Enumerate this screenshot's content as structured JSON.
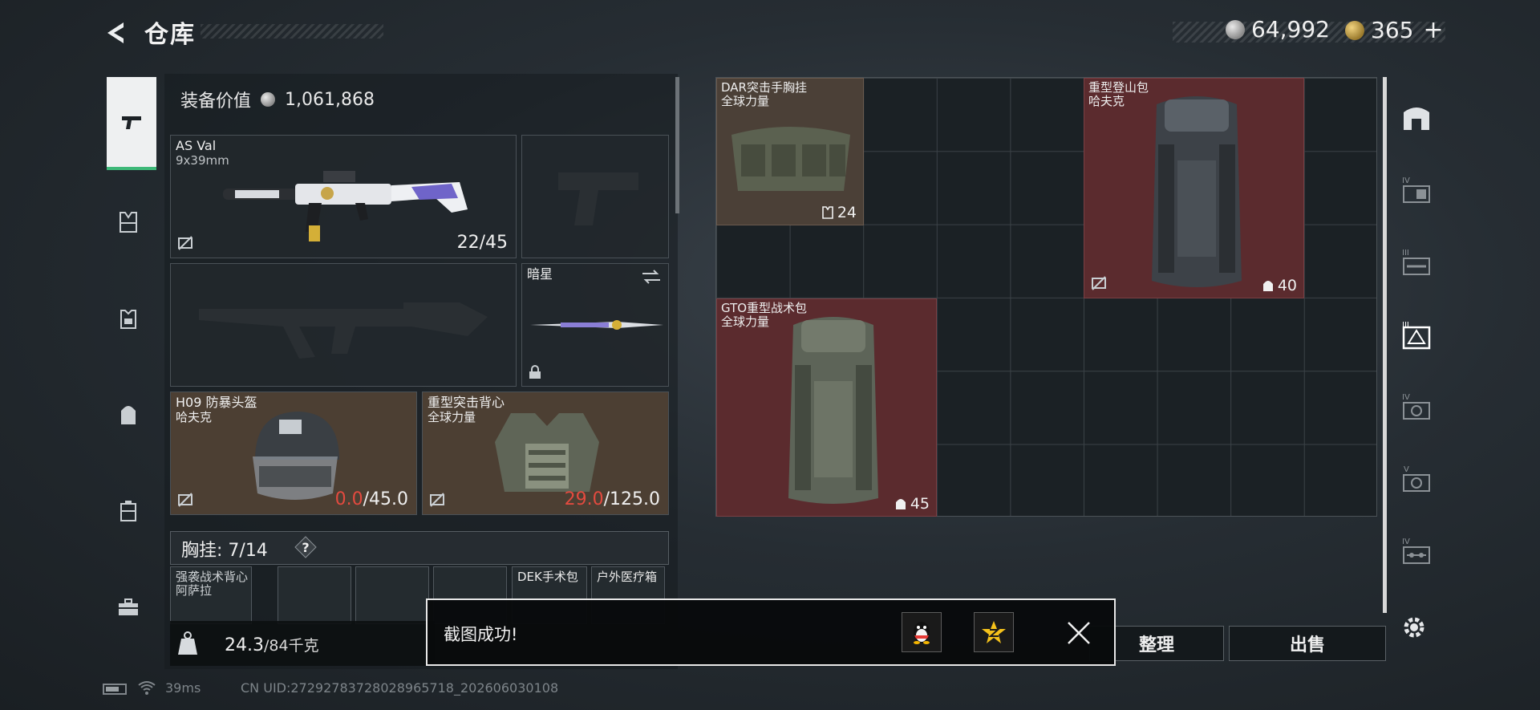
{
  "header": {
    "title": "仓库",
    "silver_amount": "64,992",
    "gold_amount": "365",
    "plus": "+"
  },
  "left_nav": [
    {
      "icon": "pistol-icon",
      "active": true
    },
    {
      "icon": "chest-rig-icon"
    },
    {
      "icon": "armor-vest-icon"
    },
    {
      "icon": "backpack-icon"
    },
    {
      "icon": "case-icon"
    },
    {
      "icon": "toolbox-icon"
    }
  ],
  "loadout": {
    "equip_value_label": "装备价值",
    "equip_value": "1,061,868",
    "primary_weapon": {
      "name": "AS Val",
      "caliber": "9x39mm",
      "ammo": "22/45"
    },
    "melee": {
      "name": "暗星"
    },
    "helmet": {
      "name": "H09 防暴头盔",
      "maker": "哈夫克",
      "durability_current": "0.0",
      "durability_max": "/45.0"
    },
    "armor": {
      "name": "重型突击背心",
      "maker": "全球力量",
      "durability_current": "29.0",
      "durability_max": "/125.0"
    },
    "chest_rig_label": "胸挂: 7/14",
    "help": "?",
    "small_slots": [
      {
        "label": "强袭战术背心\n阿萨拉"
      },
      {
        "label": ""
      },
      {
        "label": ""
      },
      {
        "label": ""
      },
      {
        "label": "DEK手术包"
      },
      {
        "label": "户外医疗箱"
      }
    ],
    "weight_value": "24.3",
    "weight_max": "/84千克"
  },
  "storage": {
    "items": [
      {
        "name": "DAR突击手胸挂",
        "maker": "全球力量",
        "count": "24",
        "color": "brown"
      },
      {
        "name": "重型登山包",
        "maker": "哈夫克",
        "count": "40",
        "color": "red"
      },
      {
        "name": "GTO重型战术包",
        "maker": "全球力量",
        "count": "45",
        "color": "red"
      }
    ]
  },
  "right_nav": [
    {
      "icon": "safe-box-icon"
    },
    {
      "icon": "tier4-container-icon",
      "tier": "IV"
    },
    {
      "icon": "tier3-container-icon",
      "tier": "III"
    },
    {
      "icon": "tier3-warning-container-icon",
      "tier": "III",
      "active": true
    },
    {
      "icon": "tier4-gear-container-icon",
      "tier": "IV"
    },
    {
      "icon": "tier5-gear-container-icon",
      "tier": "V"
    },
    {
      "icon": "tier4-pipe-container-icon",
      "tier": "IV"
    }
  ],
  "actions": {
    "sort_label": "整理",
    "sell_label": "出售"
  },
  "toast": {
    "message": "截图成功!"
  },
  "status_bar": {
    "ping": "39ms",
    "uid": "CN UID:2729278372802896571​8_202606030108"
  },
  "colors": {
    "accent_green": "#3db878",
    "durability_red": "#e34a3f",
    "item_red": "#5b2b2e",
    "item_brown": "#4b4037"
  }
}
